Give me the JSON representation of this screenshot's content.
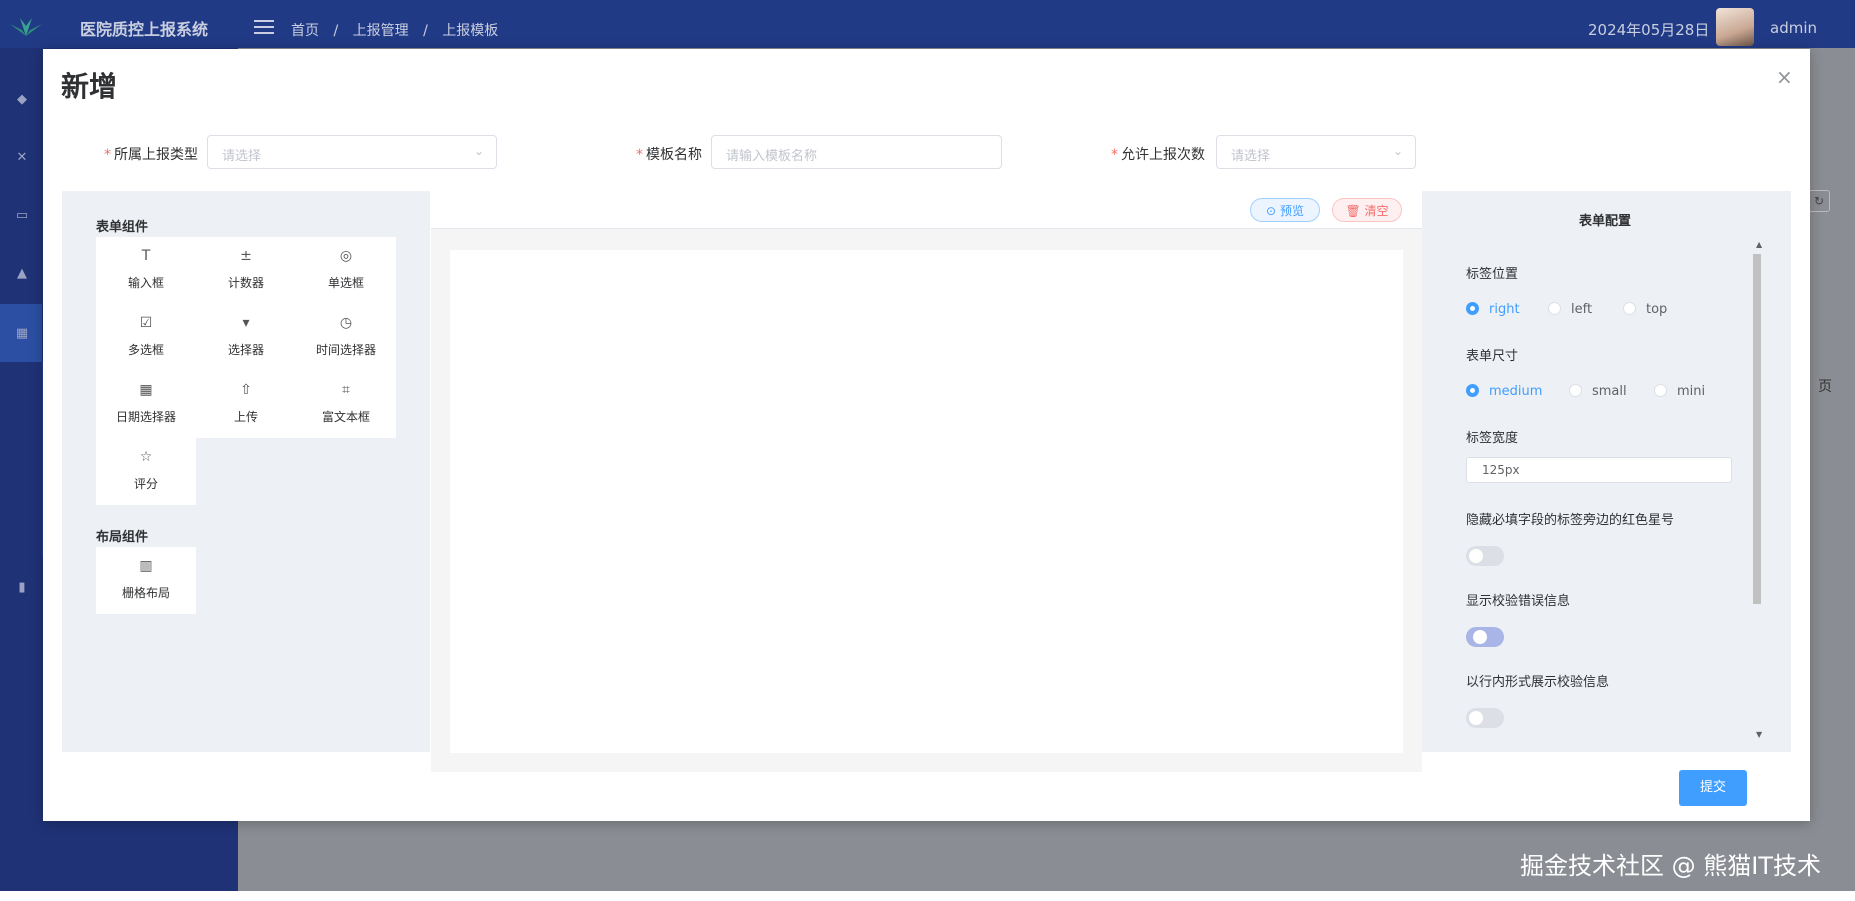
{
  "app": {
    "title": "医院质控上报系统",
    "date": "2024年05月28日",
    "user": "admin"
  },
  "breadcrumb": [
    "首页",
    "/",
    "上报管理",
    "/",
    "上报模板"
  ],
  "background": {
    "page_suffix": "页",
    "watermark": "掘金技术社区 @ 熊猫IT技术"
  },
  "dialog": {
    "title": "新增",
    "close": "×",
    "fields": {
      "report_type": {
        "label": "所属上报类型",
        "placeholder": "请选择"
      },
      "template_name": {
        "label": "模板名称",
        "placeholder": "请输入模板名称"
      },
      "allowed_count": {
        "label": "允许上报次数",
        "placeholder": "请选择"
      }
    },
    "left": {
      "form_components_title": "表单组件",
      "form_components": [
        {
          "label": "输入框",
          "icon": "T"
        },
        {
          "label": "计数器",
          "icon": "±"
        },
        {
          "label": "单选框",
          "icon": "◎"
        },
        {
          "label": "多选框",
          "icon": "☑"
        },
        {
          "label": "选择器",
          "icon": "▾"
        },
        {
          "label": "时间选择器",
          "icon": "◷"
        },
        {
          "label": "日期选择器",
          "icon": "▦"
        },
        {
          "label": "上传",
          "icon": "⇧"
        },
        {
          "label": "富文本框",
          "icon": "⌗"
        },
        {
          "label": "评分",
          "icon": "☆"
        }
      ],
      "layout_components_title": "布局组件",
      "layout_components": [
        {
          "label": "栅格布局",
          "icon": "▥"
        }
      ]
    },
    "center": {
      "preview": "预览",
      "clear": "清空"
    },
    "right": {
      "title": "表单配置",
      "label_position": {
        "label": "标签位置",
        "options": [
          "right",
          "left",
          "top"
        ],
        "selected": "right"
      },
      "form_size": {
        "label": "表单尺寸",
        "options": [
          "medium",
          "small",
          "mini"
        ],
        "selected": "medium"
      },
      "label_width": {
        "label": "标签宽度",
        "value": "125px"
      },
      "hide_required_asterisk": {
        "label": "隐藏必填字段的标签旁边的红色星号",
        "on": false
      },
      "show_message": {
        "label": "显示校验错误信息",
        "on": true
      },
      "inline_message": {
        "label": "以行内形式展示校验信息",
        "on": false
      }
    },
    "submit": "提交"
  },
  "colors": {
    "primary": "#409eff",
    "danger": "#f56c6c",
    "header": "#213a85"
  }
}
